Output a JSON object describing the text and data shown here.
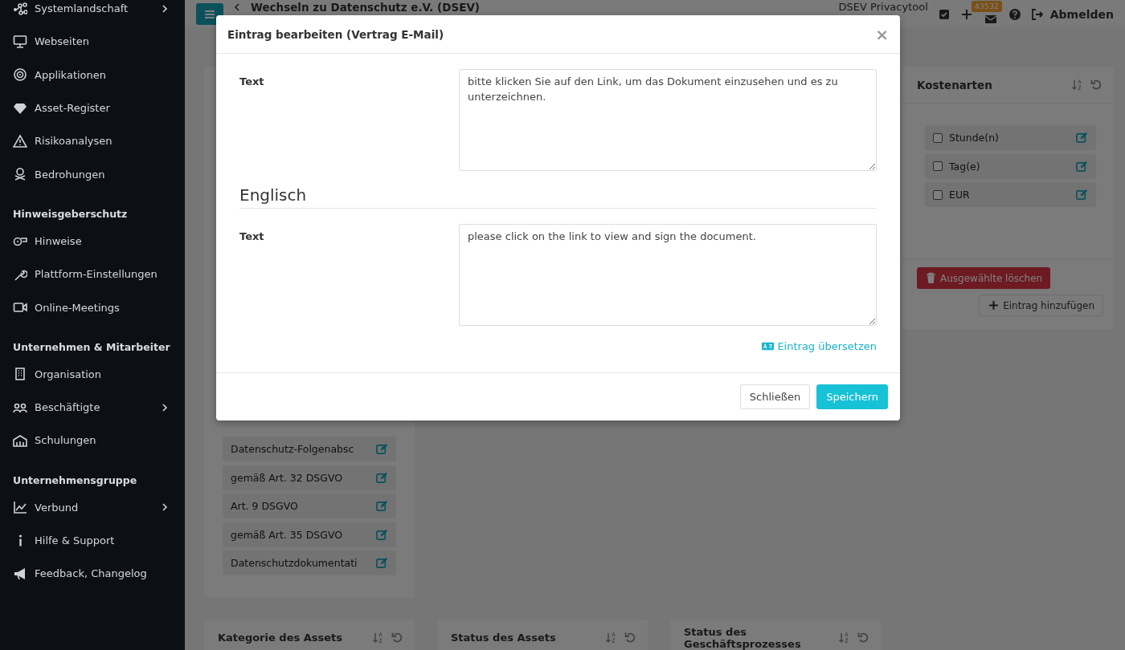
{
  "sidebar": {
    "sections": [
      {
        "items": [
          {
            "label": "Systemlandschaft",
            "submenu": true
          },
          {
            "label": "Webseiten",
            "submenu": false
          },
          {
            "label": "Applikationen",
            "submenu": false
          },
          {
            "label": "Asset-Register",
            "submenu": false
          },
          {
            "label": "Risikoanalysen",
            "submenu": false
          },
          {
            "label": "Bedrohungen",
            "submenu": false
          }
        ]
      },
      {
        "heading": "Hinweisgeberschutz",
        "items": [
          {
            "label": "Hinweise",
            "submenu": false
          },
          {
            "label": "Plattform-Einstellungen",
            "submenu": false
          },
          {
            "label": "Online-Meetings",
            "submenu": false
          }
        ]
      },
      {
        "heading": "Unternehmen & Mitarbeiter",
        "items": [
          {
            "label": "Organisation",
            "submenu": false
          },
          {
            "label": "Beschäftigte",
            "submenu": true
          },
          {
            "label": "Schulungen",
            "submenu": false
          }
        ]
      },
      {
        "heading": "Unternehmensgruppe",
        "items": [
          {
            "label": "Verbund",
            "submenu": true
          },
          {
            "label": "Hilfe & Support",
            "submenu": false
          },
          {
            "label": "Feedback, Changelog",
            "submenu": false
          }
        ]
      }
    ]
  },
  "topbar": {
    "switch_link": "Wechseln zu Datenschutz e.V. (DSEV)",
    "app_name": "DSEV Privacytool",
    "badge": "43532",
    "logout": "Abmelden"
  },
  "left_card": {
    "items": [
      {
        "label": "Datenschutz-Folgenabsc"
      },
      {
        "label": "gemäß Art. 32 DSGVO"
      },
      {
        "label": "Art. 9 DSGVO"
      },
      {
        "label": "gemäß Art. 35 DSGVO"
      },
      {
        "label": "Datenschutzdokumentati"
      }
    ]
  },
  "cost_card": {
    "title": "Kostenarten",
    "items": [
      {
        "label": "Stunde(n)",
        "checked": false
      },
      {
        "label": "Tag(e)",
        "checked": false
      },
      {
        "label": "EUR",
        "checked": false
      }
    ],
    "delete_button": "Ausgewählte löschen",
    "add_button": "Eintrag hinzufügen"
  },
  "bottom_cards": [
    {
      "title": "Kategorie des Assets"
    },
    {
      "title": "Status des Assets"
    },
    {
      "title": "Status des Geschäftsprozesses"
    }
  ],
  "modal": {
    "title": "Eintrag bearbeiten (Vertrag E-Mail)",
    "close": "×",
    "sections": [
      {
        "fields": [
          {
            "label": "Text",
            "value": "bitte klicken Sie auf den Link, um das Dokument einzusehen und es zu unterzeichnen."
          }
        ]
      },
      {
        "heading": "Englisch",
        "fields": [
          {
            "label": "Text",
            "value": "please click on the link to view and sign the document."
          }
        ]
      }
    ],
    "translate_link": "Eintrag übersetzen",
    "buttons": [
      {
        "label": "Schließen",
        "kind": "secondary"
      },
      {
        "label": "Speichern",
        "kind": "primary"
      }
    ]
  }
}
